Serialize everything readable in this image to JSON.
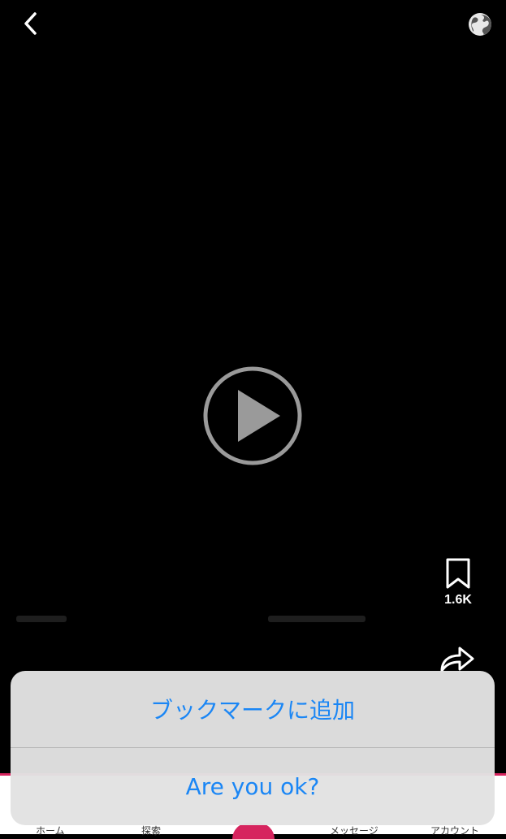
{
  "top_bar": {
    "back_icon": "chevron-left-icon",
    "globe_icon": "globe-icon"
  },
  "player": {
    "play_icon": "play-circle-icon"
  },
  "actions": {
    "bookmark_icon": "bookmark-icon",
    "bookmark_count": "1.6K",
    "share_icon": "share-arrow-icon"
  },
  "bottom_nav": {
    "items": [
      {
        "label": "ホーム"
      },
      {
        "label": "探索"
      },
      {
        "label": "メッセージ"
      },
      {
        "label": "アカウント"
      }
    ]
  },
  "action_sheet": {
    "options": [
      {
        "label": "ブックマークに追加"
      },
      {
        "label": "Are you ok?"
      }
    ]
  },
  "colors": {
    "accent": "#1a86f5",
    "brand": "#d6245e",
    "background": "#000000"
  }
}
